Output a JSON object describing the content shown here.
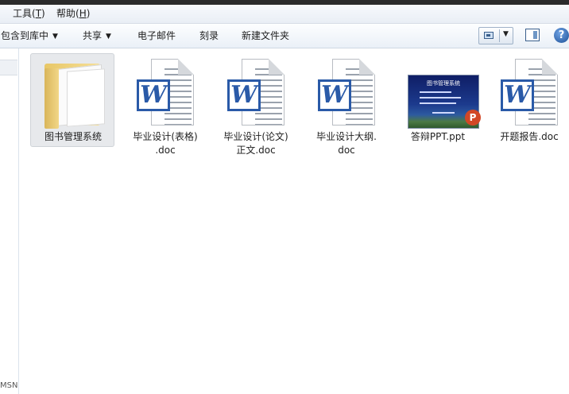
{
  "menubar": {
    "items": [
      {
        "label": "工具(",
        "accel": "T",
        "suffix": ")"
      },
      {
        "label": "帮助(",
        "accel": "H",
        "suffix": ")"
      }
    ]
  },
  "toolbar": {
    "include_library": "包含到库中",
    "share": "共享",
    "email": "电子邮件",
    "burn": "刻录",
    "new_folder": "新建文件夹",
    "dropdown_caret": "▼",
    "help": "?"
  },
  "nav_pane": {
    "truncated_text": "MSN"
  },
  "files": [
    {
      "name": "图书管理系统",
      "type": "folder",
      "selected": true
    },
    {
      "name": "毕业设计(表格)\n.doc",
      "type": "word"
    },
    {
      "name": "毕业设计(论文)\n正文.doc",
      "type": "word"
    },
    {
      "name": "毕业设计大纲.\ndoc",
      "type": "word"
    },
    {
      "name": "答辩PPT.ppt",
      "type": "ppt"
    },
    {
      "name": "开题报告.doc",
      "type": "word"
    }
  ],
  "ppt_thumbnail": {
    "title": "图书管理系统"
  },
  "icons": {
    "word_letter": "W",
    "ppt_letter": "P"
  },
  "colors": {
    "word_blue": "#2a5aa8",
    "ppt_orange": "#d24726",
    "folder_yellow": "#f6df98",
    "selection_bg": "#e7e9ec"
  }
}
